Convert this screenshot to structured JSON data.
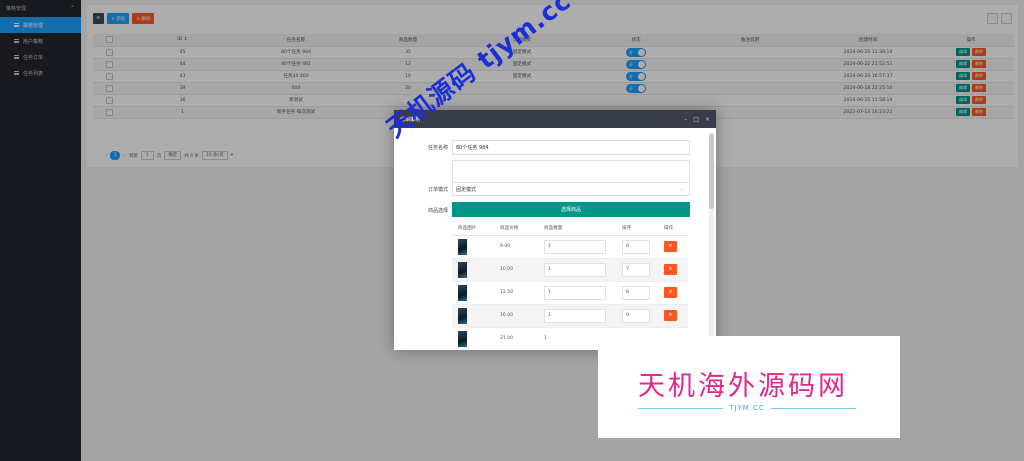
{
  "sidebar": {
    "header": "策略管理",
    "items": [
      {
        "label": "策略管理",
        "active": true
      },
      {
        "label": "用户策略",
        "active": false
      },
      {
        "label": "任务订单",
        "active": false
      },
      {
        "label": "任务列表",
        "active": false
      }
    ]
  },
  "toolbar": {
    "add_label": "+ 添加",
    "delete_label": "× 删除"
  },
  "table": {
    "columns": [
      "",
      "ID ↕",
      "任务名称",
      "商品数量",
      "订单模式",
      "状态",
      "备注说明",
      "创建时间",
      "操作"
    ],
    "rows": [
      {
        "id": "45",
        "name": "80个任务 984",
        "count": "35",
        "mode": "固定模式",
        "status": "开",
        "note": "",
        "time": "2024-06-25 11:39:10"
      },
      {
        "id": "44",
        "name": "40个任务 481",
        "count": "12",
        "mode": "固定模式",
        "status": "开",
        "note": "",
        "time": "2024-06-22 21:52:51"
      },
      {
        "id": "43",
        "name": "任务30 400",
        "count": "10",
        "mode": "固定模式",
        "status": "开",
        "note": "",
        "time": "2024-06-20 16:57:37"
      },
      {
        "id": "39",
        "name": "000",
        "count": "20",
        "mode": "",
        "status": "开",
        "note": "",
        "time": "2024-06-18 22:25:10"
      },
      {
        "id": "36",
        "name": "新测试",
        "count": "",
        "mode": "",
        "status": "",
        "note": "",
        "time": "2014-06-15 11:58:19"
      },
      {
        "id": "1",
        "name": "新手任务 每次测试",
        "count": "",
        "mode": "",
        "status": "",
        "note": "",
        "time": "2022-07-13 16:23:21"
      }
    ],
    "edit_label": "编辑",
    "delete_label": "删除"
  },
  "pager": {
    "current": "1",
    "goto_label": "到第",
    "page_value": "1",
    "page_unit": "页",
    "confirm": "确定",
    "total": "共 6 条",
    "per_page": "10 条/页"
  },
  "modal": {
    "title": "编辑策略",
    "fields": [
      {
        "label": "任务名称",
        "value": "80个任务 984"
      },
      {
        "label": "",
        "value": ""
      },
      {
        "label": "订单模式",
        "value": "固定模式"
      },
      {
        "label": "商品选择",
        "value": ""
      }
    ],
    "pick_button": "选择商品",
    "sub_columns": [
      "商品图片",
      "商品价格",
      "商品数量",
      "排序",
      "操作"
    ],
    "sub_rows": [
      {
        "price": "9.00",
        "qty": "1",
        "sort": "6"
      },
      {
        "price": "10.00",
        "qty": "1",
        "sort": "7"
      },
      {
        "price": "12.50",
        "qty": "1",
        "sort": "8"
      },
      {
        "price": "16.00",
        "qty": "1",
        "sort": "9"
      },
      {
        "price": "21.00",
        "qty": "1",
        "sort": ""
      }
    ],
    "remove_label": "×"
  },
  "watermarks": {
    "diagonal": "天机源码 tjym.cc",
    "box_title": "天机海外源码网",
    "box_sub": "TJYM.CC"
  }
}
